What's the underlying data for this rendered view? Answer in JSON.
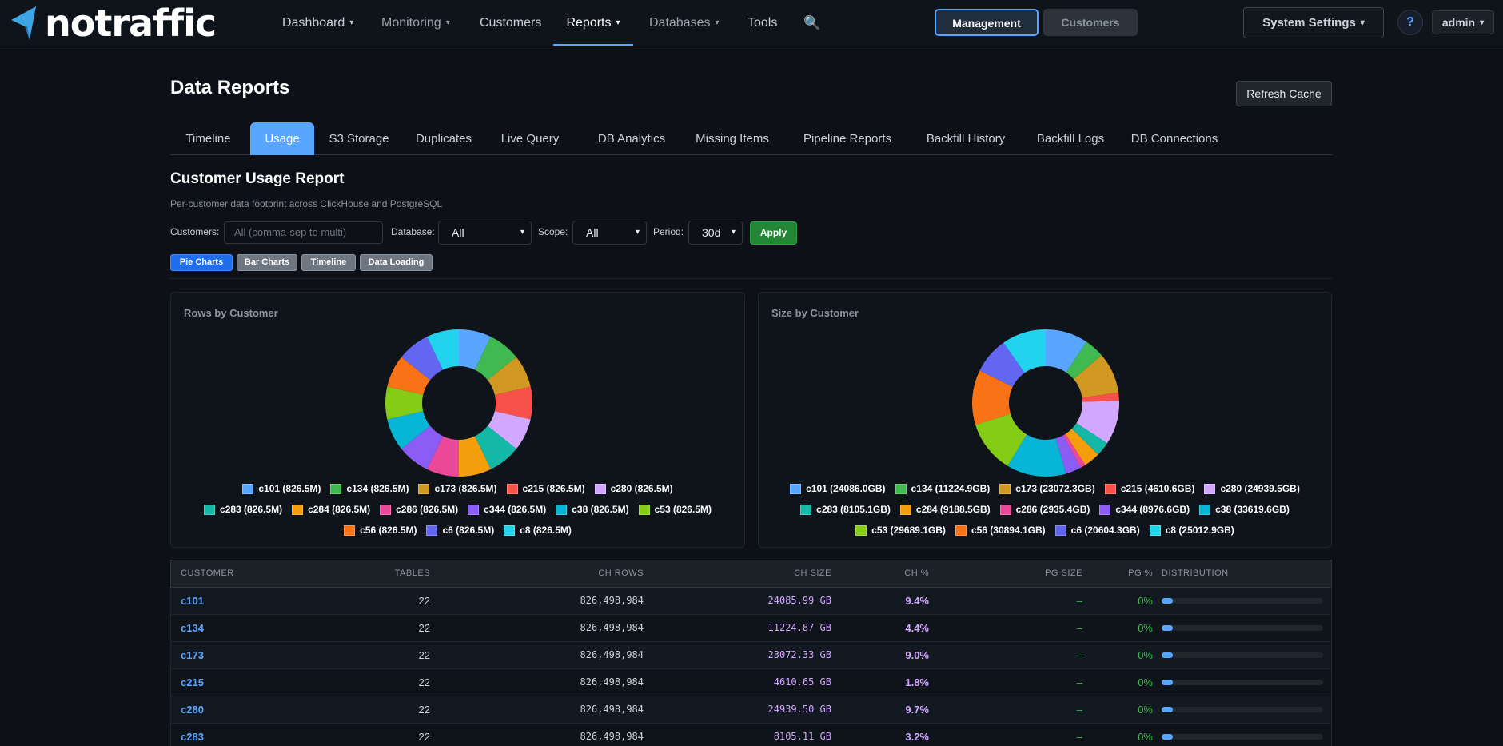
{
  "brand": {
    "name": "notraffic"
  },
  "nav": {
    "items": [
      {
        "label": "Dashboard",
        "caret": "▾"
      },
      {
        "label": "Monitoring",
        "caret": "▾"
      },
      {
        "label": "Customers"
      },
      {
        "label": "Reports",
        "caret": "▾"
      },
      {
        "label": "Databases",
        "caret": "▾"
      },
      {
        "label": "Tools"
      }
    ],
    "search_icon": "🔍",
    "mode_management": "Management",
    "mode_customers": "Customers",
    "system_settings": "System Settings",
    "system_settings_caret": "▾",
    "help": "?",
    "user": "admin",
    "user_caret": "▾"
  },
  "page": {
    "title": "Data Reports",
    "refresh_label": "Refresh Cache"
  },
  "tabs": [
    "Timeline",
    "Usage",
    "S3 Storage",
    "Duplicates",
    "Live Query",
    "DB Analytics",
    "Missing Items",
    "Pipeline Reports",
    "Backfill History",
    "Backfill Logs",
    "DB Connections"
  ],
  "active_tab": "Usage",
  "report": {
    "title": "Customer Usage Report",
    "subtitle": "Per-customer data footprint across ClickHouse and PostgreSQL"
  },
  "filters": {
    "customers_label": "Customers:",
    "customers_placeholder": "All (comma-sep to multi)",
    "database_label": "Database:",
    "database_value": "All",
    "scope_label": "Scope:",
    "scope_value": "All",
    "period_label": "Period:",
    "period_value": "30d",
    "dropdown_caret": "▾",
    "apply_label": "Apply"
  },
  "views": [
    "Pie Charts",
    "Bar Charts",
    "Timeline",
    "Data Loading"
  ],
  "active_view": "Pie Charts",
  "colors": {
    "accent": "#58a6ff",
    "slices": [
      "#58a6ff",
      "#3fb950",
      "#d29922",
      "#f85149",
      "#d2a8ff",
      "#14b8a6",
      "#f59e0b",
      "#ec4899",
      "#8b5cf6",
      "#06b6d4",
      "#84cc16",
      "#f97316",
      "#6366f1",
      "#22d3ee"
    ]
  },
  "chart_data": [
    {
      "type": "pie",
      "title": "Rows by Customer",
      "labels": [
        "c101 (826.5M)",
        "c134 (826.5M)",
        "c173 (826.5M)",
        "c215 (826.5M)",
        "c280 (826.5M)",
        "c283 (826.5M)",
        "c284 (826.5M)",
        "c286 (826.5M)",
        "c344 (826.5M)",
        "c38 (826.5M)",
        "c53 (826.5M)",
        "c56 (826.5M)",
        "c6 (826.5M)",
        "c8 (826.5M)"
      ],
      "values": [
        826.5,
        826.5,
        826.5,
        826.5,
        826.5,
        826.5,
        826.5,
        826.5,
        826.5,
        826.5,
        826.5,
        826.5,
        826.5,
        826.5
      ],
      "legend_rows": [
        5,
        6,
        3
      ]
    },
    {
      "type": "pie",
      "title": "Size by Customer",
      "labels": [
        "c101 (24086.0GB)",
        "c134 (11224.9GB)",
        "c173 (23072.3GB)",
        "c215 (4610.6GB)",
        "c280 (24939.5GB)",
        "c283 (8105.1GB)",
        "c284 (9188.5GB)",
        "c286 (2935.4GB)",
        "c344 (8976.6GB)",
        "c38 (33619.6GB)",
        "c53 (29689.1GB)",
        "c56 (30894.1GB)",
        "c6 (20604.3GB)",
        "c8 (25012.9GB)"
      ],
      "values": [
        24086.0,
        11224.9,
        23072.3,
        4610.6,
        24939.5,
        8105.1,
        9188.5,
        2935.4,
        8976.6,
        33619.6,
        29689.1,
        30894.1,
        20604.3,
        25012.9
      ],
      "legend_rows": [
        5,
        5,
        4
      ]
    }
  ],
  "table": {
    "headers": [
      "CUSTOMER",
      "TABLES",
      "CH ROWS",
      "CH SIZE",
      "CH %",
      "PG SIZE",
      "PG %",
      "DISTRIBUTION"
    ],
    "rows": [
      {
        "customer": "c101",
        "tables": "22",
        "ch_rows": "826,498,984",
        "ch_size": "24085.99 GB",
        "ch_pct": "9.4%",
        "pg_size": "–",
        "pg_pct": "0%",
        "distribution": 0.07
      },
      {
        "customer": "c134",
        "tables": "22",
        "ch_rows": "826,498,984",
        "ch_size": "11224.87 GB",
        "ch_pct": "4.4%",
        "pg_size": "–",
        "pg_pct": "0%",
        "distribution": 0.07
      },
      {
        "customer": "c173",
        "tables": "22",
        "ch_rows": "826,498,984",
        "ch_size": "23072.33 GB",
        "ch_pct": "9.0%",
        "pg_size": "–",
        "pg_pct": "0%",
        "distribution": 0.07
      },
      {
        "customer": "c215",
        "tables": "22",
        "ch_rows": "826,498,984",
        "ch_size": "4610.65 GB",
        "ch_pct": "1.8%",
        "pg_size": "–",
        "pg_pct": "0%",
        "distribution": 0.07
      },
      {
        "customer": "c280",
        "tables": "22",
        "ch_rows": "826,498,984",
        "ch_size": "24939.50 GB",
        "ch_pct": "9.7%",
        "pg_size": "–",
        "pg_pct": "0%",
        "distribution": 0.07
      },
      {
        "customer": "c283",
        "tables": "22",
        "ch_rows": "826,498,984",
        "ch_size": "8105.11 GB",
        "ch_pct": "3.2%",
        "pg_size": "–",
        "pg_pct": "0%",
        "distribution": 0.07
      }
    ]
  }
}
